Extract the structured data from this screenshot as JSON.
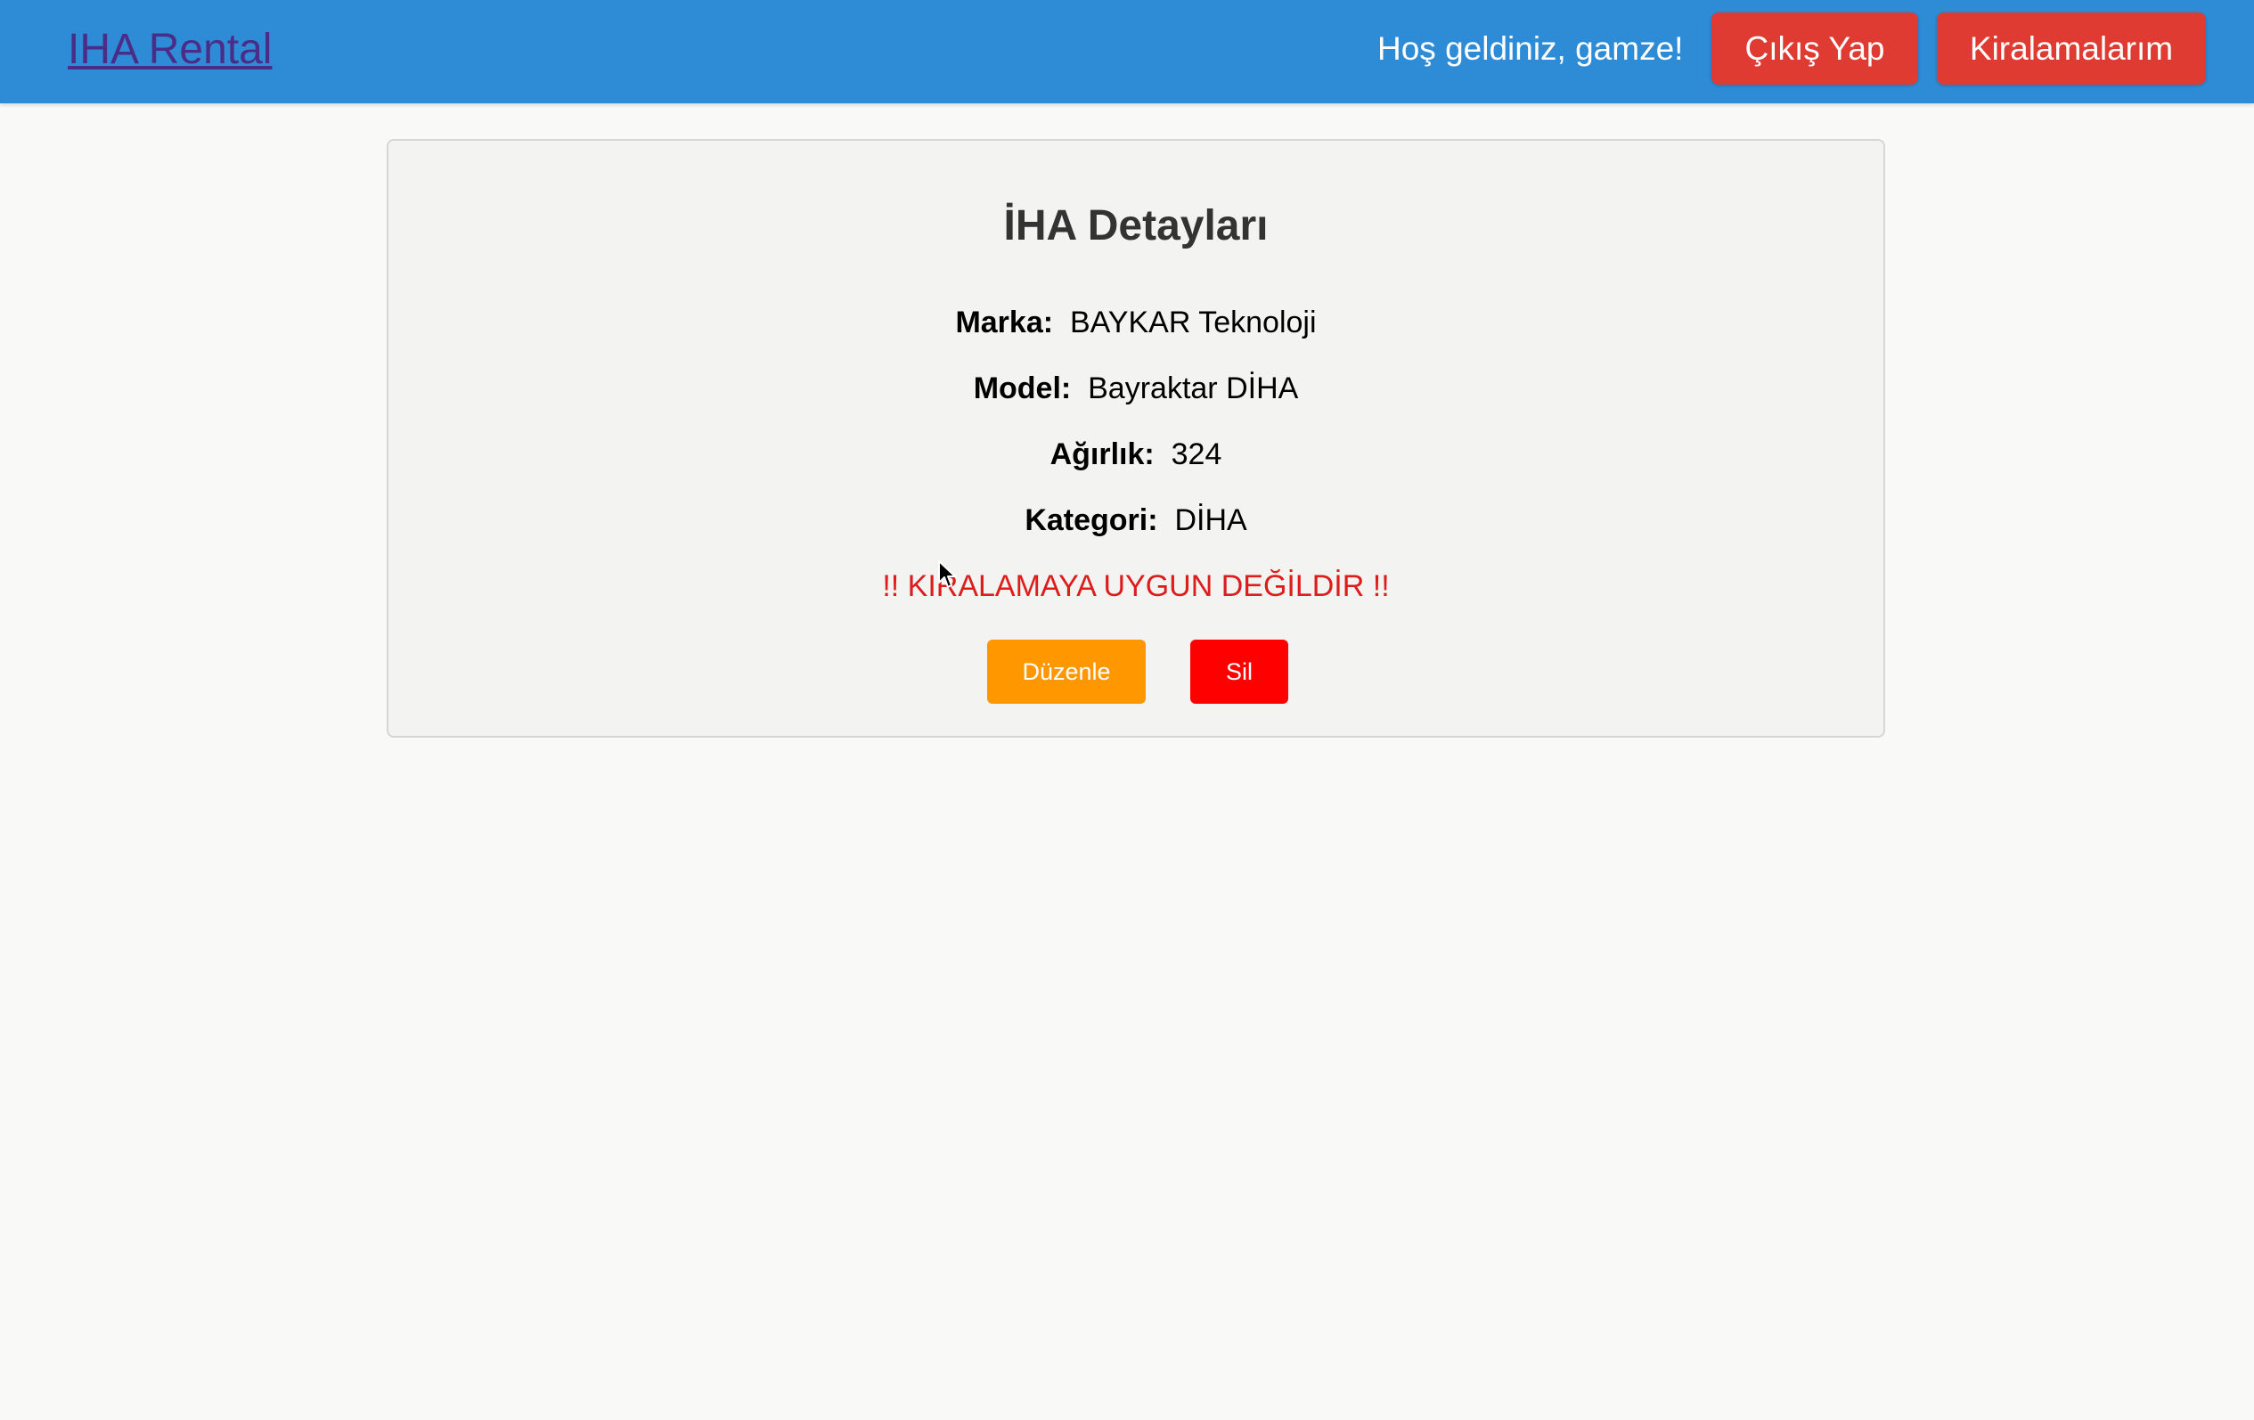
{
  "navbar": {
    "brand": "IHA Rental",
    "welcome": "Hoş geldiniz, gamze!",
    "logout_label": "Çıkış Yap",
    "rentals_label": "Kiralamalarım",
    "colors": {
      "background": "#2e8bd6",
      "button": "#e03b32"
    }
  },
  "detail": {
    "title": "İHA Detayları",
    "rows": [
      {
        "label": "Marka:",
        "value": "BAYKAR Teknoloji"
      },
      {
        "label": "Model:",
        "value": "Bayraktar DİHA"
      },
      {
        "label": "Ağırlık:",
        "value": "324"
      },
      {
        "label": "Kategori:",
        "value": "DİHA"
      }
    ],
    "warning": "!! KIRALAMAYA UYGUN DEĞİLDİR !!",
    "edit_label": "Düzenle",
    "delete_label": "Sil",
    "colors": {
      "edit": "#ff9800",
      "delete": "#ff0000",
      "warning": "#dd1c1c"
    }
  }
}
